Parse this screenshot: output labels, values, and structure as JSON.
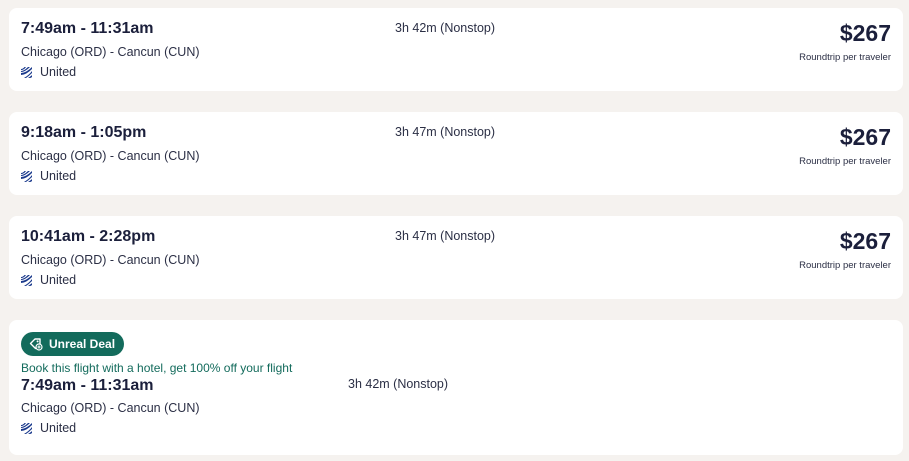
{
  "flights": [
    {
      "times": "7:49am - 11:31am",
      "route": "Chicago (ORD) - Cancun (CUN)",
      "airline": "United",
      "duration": "3h 42m (Nonstop)",
      "price": "$267",
      "price_note": "Roundtrip per traveler"
    },
    {
      "times": "9:18am - 1:05pm",
      "route": "Chicago (ORD) - Cancun (CUN)",
      "airline": "United",
      "duration": "3h 47m (Nonstop)",
      "price": "$267",
      "price_note": "Roundtrip per traveler"
    },
    {
      "times": "10:41am - 2:28pm",
      "route": "Chicago (ORD) - Cancun (CUN)",
      "airline": "United",
      "duration": "3h 47m (Nonstop)",
      "price": "$267",
      "price_note": "Roundtrip per traveler"
    }
  ],
  "deal_flight": {
    "badge": "Unreal Deal",
    "deal_text": "Book this flight with a hotel, get 100% off your flight",
    "times": "7:49am - 11:31am",
    "route": "Chicago (ORD) - Cancun (CUN)",
    "airline": "United",
    "duration": "3h 42m (Nonstop)"
  },
  "icons": {
    "airline_logo": "united-airlines-logo-icon",
    "deal_badge": "deal-tag-icon"
  },
  "colors": {
    "background": "#f5f2ef",
    "card": "#ffffff",
    "text_primary": "#1b1f3b",
    "deal_green": "#136b5c",
    "united_blue": "#1b3a8c"
  }
}
